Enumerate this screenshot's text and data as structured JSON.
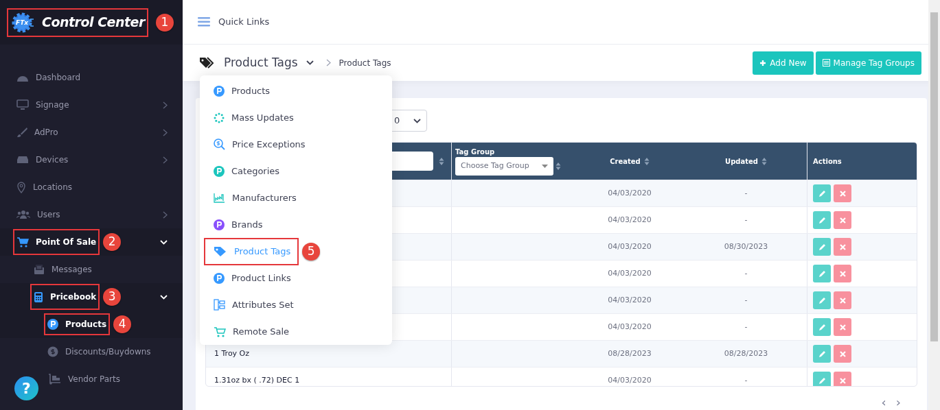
{
  "sidebar": {
    "logo": {
      "badge": "FTx",
      "title": "Control Center",
      "callout": "1"
    },
    "items": [
      {
        "label": "Dashboard",
        "active": false
      },
      {
        "label": "Signage",
        "expanded": false,
        "active": false
      },
      {
        "label": "AdPro",
        "expanded": false,
        "active": false
      },
      {
        "label": "Devices",
        "expanded": false,
        "active": false
      },
      {
        "label": "Locations",
        "active": false
      },
      {
        "label": "Users",
        "expanded": false,
        "active": false
      },
      {
        "label": "Point Of Sale",
        "expanded": true,
        "active": true,
        "callout": "2",
        "children": [
          {
            "label": "Messages",
            "active": false
          },
          {
            "label": "Pricebook",
            "expanded": true,
            "active": true,
            "callout": "3",
            "children": [
              {
                "label": "Products",
                "active": true,
                "callout": "4"
              },
              {
                "label": "Discounts/Buydowns",
                "active": false
              },
              {
                "label": "Vendor Parts",
                "active": false
              }
            ]
          }
        ]
      }
    ],
    "help_button": "?"
  },
  "topbar": {
    "label": "Quick Links"
  },
  "subheader": {
    "title": "Product Tags",
    "breadcrumb": "Product Tags",
    "buttons": [
      {
        "label": "Add New",
        "kind": "add"
      },
      {
        "label": "Manage Tag Groups",
        "kind": "list"
      }
    ]
  },
  "menu": [
    {
      "label": "Products",
      "selected": false
    },
    {
      "label": "Mass Updates",
      "selected": false
    },
    {
      "label": "Price Exceptions",
      "selected": false
    },
    {
      "label": "Categories",
      "selected": false
    },
    {
      "label": "Manufacturers",
      "selected": false
    },
    {
      "label": "Brands",
      "selected": false
    },
    {
      "label": "Product Tags",
      "selected": true,
      "callout": "5"
    },
    {
      "label": "Product Links",
      "selected": false
    },
    {
      "label": "Attributes Set",
      "selected": false
    },
    {
      "label": "Remote Sale",
      "selected": false
    }
  ],
  "page_size": {
    "value": "0"
  },
  "table": {
    "columns": [
      {
        "kind": "filter"
      },
      {
        "kind": "select",
        "label": "Tag Group",
        "placeholder": "Choose Tag Group"
      },
      {
        "kind": "sort",
        "label": "Created"
      },
      {
        "kind": "sort",
        "label": "Updated"
      },
      {
        "kind": "plain",
        "label": "Actions"
      }
    ],
    "rows": [
      {
        "created": "04/03/2020",
        "updated": "-"
      },
      {
        "created": "04/03/2020",
        "updated": "-"
      },
      {
        "created": "04/03/2020",
        "updated": "08/30/2023"
      },
      {
        "created": "04/03/2020",
        "updated": "-"
      },
      {
        "created": "04/03/2020",
        "updated": "-"
      },
      {
        "created": "04/03/2020",
        "updated": "-"
      },
      {
        "name": "1 Troy Oz",
        "created": "08/28/2023",
        "updated": "08/28/2023"
      },
      {
        "name": "1.31oz bx ( .72) DEC 1",
        "created": "04/03/2020",
        "updated": "-"
      }
    ]
  },
  "pagination": {
    "prev": "‹",
    "next": "›"
  }
}
